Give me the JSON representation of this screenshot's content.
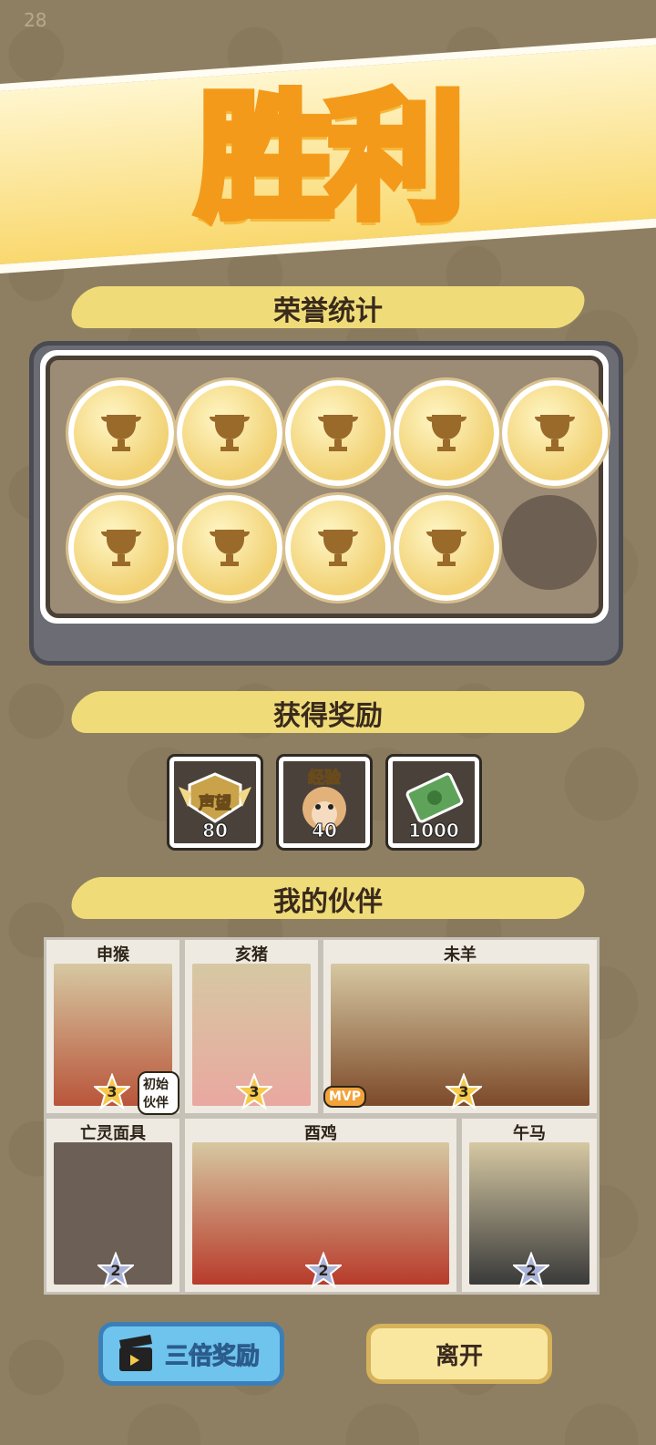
{
  "status": {
    "corner_number": "28"
  },
  "banner": {
    "title": "胜利"
  },
  "honor": {
    "title": "荣誉统计",
    "earned_count": 9,
    "total_slots": 10
  },
  "rewards": {
    "title": "获得奖励",
    "items": [
      {
        "label": "声望",
        "value": "80",
        "icon": "reputation-badge-icon"
      },
      {
        "label": "经验",
        "value": "40",
        "icon": "monkey-exp-icon"
      },
      {
        "label": "",
        "value": "1000",
        "icon": "money-bill-icon"
      }
    ]
  },
  "partners": {
    "title": "我的伙伴",
    "cards": [
      {
        "name": "申猴",
        "stars": "3",
        "tag": "初始伙伴"
      },
      {
        "name": "亥猪",
        "stars": "3"
      },
      {
        "name": "未羊",
        "stars": "3",
        "tag": "MVP"
      },
      {
        "name": "亡灵面具",
        "stars": "2"
      },
      {
        "name": "酉鸡",
        "stars": "2"
      },
      {
        "name": "午马",
        "stars": "2"
      }
    ]
  },
  "buttons": {
    "triple": "三倍奖励",
    "leave": "离开"
  },
  "colors": {
    "coin": "#f1d173",
    "board": "#9c8b75",
    "triple_btn": "#6fc4ee",
    "leave_btn": "#f9e7a0"
  }
}
